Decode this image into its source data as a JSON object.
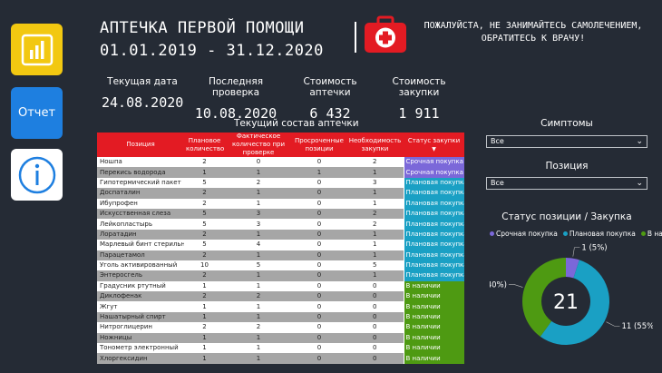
{
  "nav": {
    "report_label": "Отчет",
    "pbi_color": "#f2c811",
    "report_color": "#1e7fe0",
    "icons": [
      "powerbi-icon",
      "info-icon"
    ]
  },
  "header": {
    "title_line1": "АПТЕЧКА ПЕРВОЙ ПОМОЩИ",
    "title_line2": "01.01.2019 - 31.12.2020",
    "warning_line1": "ПОЖАЛУЙСТА, НЕ ЗАНИМАЙТЕСЬ САМОЛЕЧЕНИЕМ,",
    "warning_line2": "ОБРАТИТЕСЬ К ВРАЧУ!"
  },
  "kpis": [
    {
      "label": "Текущая дата",
      "value": "24.08.2020"
    },
    {
      "label": "Последняя проверка",
      "value": "10.08.2020"
    },
    {
      "label": "Стоимость аптечки",
      "value": "6 432"
    },
    {
      "label": "Стоимость закупки",
      "value": "1 911"
    }
  ],
  "table": {
    "title": "Текущий состав аптечки",
    "headers": [
      "Позиция",
      "Плановое количество",
      "Фактическое количество при проверке",
      "Просроченные позиции",
      "Необходимость закупки",
      "Статус закупки"
    ],
    "status_colors": {
      "Срочная покупка": "#7b68d9",
      "Плановая покупка": "#1aa0c4",
      "В наличии": "#4e9a12"
    },
    "rows": [
      [
        "Ношпа",
        "2",
        "0",
        "0",
        "2",
        "Срочная покупка"
      ],
      [
        "Перекись водорода",
        "1",
        "1",
        "1",
        "1",
        "Срочная покупка"
      ],
      [
        "Гипотермический пакет",
        "5",
        "2",
        "0",
        "3",
        "Плановая покупка"
      ],
      [
        "Доспаталин",
        "2",
        "1",
        "0",
        "1",
        "Плановая покупка"
      ],
      [
        "Ибупрофен",
        "2",
        "1",
        "0",
        "1",
        "Плановая покупка"
      ],
      [
        "Искусственная слеза",
        "5",
        "3",
        "0",
        "2",
        "Плановая покупка"
      ],
      [
        "Лейкопластырь",
        "5",
        "3",
        "0",
        "2",
        "Плановая покупка"
      ],
      [
        "Лоратадин",
        "2",
        "1",
        "0",
        "1",
        "Плановая покупка"
      ],
      [
        "Марлевый бинт стерильный",
        "5",
        "4",
        "0",
        "1",
        "Плановая покупка"
      ],
      [
        "Парацетамол",
        "2",
        "1",
        "0",
        "1",
        "Плановая покупка"
      ],
      [
        "Уголь активированный",
        "10",
        "5",
        "0",
        "5",
        "Плановая покупка"
      ],
      [
        "Энтеросгель",
        "2",
        "1",
        "0",
        "1",
        "Плановая покупка"
      ],
      [
        "Градусник ртутный",
        "1",
        "1",
        "0",
        "0",
        "В наличии"
      ],
      [
        "Диклофенак",
        "2",
        "2",
        "0",
        "0",
        "В наличии"
      ],
      [
        "Жгут",
        "1",
        "1",
        "0",
        "0",
        "В наличии"
      ],
      [
        "Нашатырный спирт",
        "1",
        "1",
        "0",
        "0",
        "В наличии"
      ],
      [
        "Нитроглицерин",
        "2",
        "2",
        "0",
        "0",
        "В наличии"
      ],
      [
        "Ножницы",
        "1",
        "1",
        "0",
        "0",
        "В наличии"
      ],
      [
        "Тонометр электронный",
        "1",
        "1",
        "0",
        "0",
        "В наличии"
      ],
      [
        "Хлоргексидин",
        "1",
        "1",
        "0",
        "0",
        "В наличии"
      ]
    ]
  },
  "filters": {
    "symptoms": {
      "title": "Симптомы",
      "value": "Все"
    },
    "position": {
      "title": "Позиция",
      "value": "Все"
    }
  },
  "chart_data": {
    "type": "pie",
    "title": "Статус позиции / Закупка",
    "categories": [
      "Срочная покупка",
      "Плановая покупка",
      "В наличии"
    ],
    "values": [
      1,
      11,
      8
    ],
    "percent_labels": [
      "1 (5%)",
      "11 (55%)",
      "8 (40%)"
    ],
    "center_value": "21",
    "colors": [
      "#7b68d9",
      "#1aa0c4",
      "#4e9a12"
    ],
    "legend_position": "top"
  }
}
